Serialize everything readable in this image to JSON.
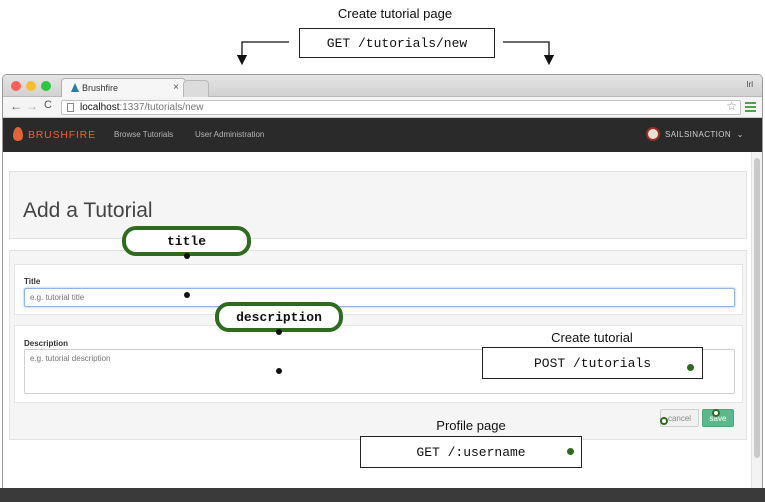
{
  "annotations": {
    "create_page": {
      "caption": "Create tutorial page",
      "route": "GET /tutorials/new"
    },
    "title_pill": "title",
    "description_pill": "description",
    "create_tutorial": {
      "caption": "Create tutorial",
      "route": "POST /tutorials"
    },
    "profile_page": {
      "caption": "Profile page",
      "route": "GET /:username"
    }
  },
  "browser": {
    "tab_title": "Brushfire",
    "tab_close": "×",
    "url_host": "localhost",
    "url_path": ":1337/tutorials/new",
    "window_label": "lrl"
  },
  "navbar": {
    "brand": "BRUSHFIRE",
    "links": [
      "Browse Tutorials",
      "User Administration"
    ],
    "user": "SAILSINACTION"
  },
  "form": {
    "heading": "Add a Tutorial",
    "title_label": "Title",
    "title_placeholder": "e.g. tutorial title",
    "description_label": "Description",
    "description_placeholder": "e.g. tutorial description",
    "cancel_label": "cancel",
    "save_label": "save"
  },
  "colors": {
    "annotation_green": "#2f6b1e",
    "brand_orange": "#e3643a",
    "save_green": "#5cb88a",
    "navbar_bg": "#2a2a2a"
  }
}
